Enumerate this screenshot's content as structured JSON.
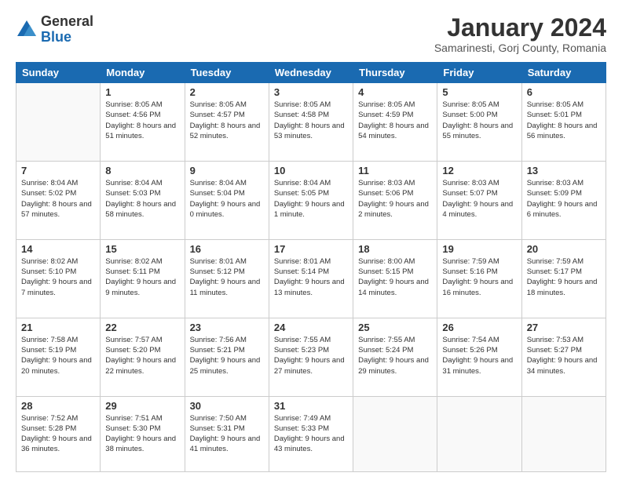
{
  "header": {
    "logo_general": "General",
    "logo_blue": "Blue",
    "month_title": "January 2024",
    "location": "Samarinesti, Gorj County, Romania"
  },
  "days_of_week": [
    "Sunday",
    "Monday",
    "Tuesday",
    "Wednesday",
    "Thursday",
    "Friday",
    "Saturday"
  ],
  "weeks": [
    [
      {
        "day": "",
        "info": ""
      },
      {
        "day": "1",
        "info": "Sunrise: 8:05 AM\nSunset: 4:56 PM\nDaylight: 8 hours\nand 51 minutes."
      },
      {
        "day": "2",
        "info": "Sunrise: 8:05 AM\nSunset: 4:57 PM\nDaylight: 8 hours\nand 52 minutes."
      },
      {
        "day": "3",
        "info": "Sunrise: 8:05 AM\nSunset: 4:58 PM\nDaylight: 8 hours\nand 53 minutes."
      },
      {
        "day": "4",
        "info": "Sunrise: 8:05 AM\nSunset: 4:59 PM\nDaylight: 8 hours\nand 54 minutes."
      },
      {
        "day": "5",
        "info": "Sunrise: 8:05 AM\nSunset: 5:00 PM\nDaylight: 8 hours\nand 55 minutes."
      },
      {
        "day": "6",
        "info": "Sunrise: 8:05 AM\nSunset: 5:01 PM\nDaylight: 8 hours\nand 56 minutes."
      }
    ],
    [
      {
        "day": "7",
        "info": "Sunrise: 8:04 AM\nSunset: 5:02 PM\nDaylight: 8 hours\nand 57 minutes."
      },
      {
        "day": "8",
        "info": "Sunrise: 8:04 AM\nSunset: 5:03 PM\nDaylight: 8 hours\nand 58 minutes."
      },
      {
        "day": "9",
        "info": "Sunrise: 8:04 AM\nSunset: 5:04 PM\nDaylight: 9 hours\nand 0 minutes."
      },
      {
        "day": "10",
        "info": "Sunrise: 8:04 AM\nSunset: 5:05 PM\nDaylight: 9 hours\nand 1 minute."
      },
      {
        "day": "11",
        "info": "Sunrise: 8:03 AM\nSunset: 5:06 PM\nDaylight: 9 hours\nand 2 minutes."
      },
      {
        "day": "12",
        "info": "Sunrise: 8:03 AM\nSunset: 5:07 PM\nDaylight: 9 hours\nand 4 minutes."
      },
      {
        "day": "13",
        "info": "Sunrise: 8:03 AM\nSunset: 5:09 PM\nDaylight: 9 hours\nand 6 minutes."
      }
    ],
    [
      {
        "day": "14",
        "info": "Sunrise: 8:02 AM\nSunset: 5:10 PM\nDaylight: 9 hours\nand 7 minutes."
      },
      {
        "day": "15",
        "info": "Sunrise: 8:02 AM\nSunset: 5:11 PM\nDaylight: 9 hours\nand 9 minutes."
      },
      {
        "day": "16",
        "info": "Sunrise: 8:01 AM\nSunset: 5:12 PM\nDaylight: 9 hours\nand 11 minutes."
      },
      {
        "day": "17",
        "info": "Sunrise: 8:01 AM\nSunset: 5:14 PM\nDaylight: 9 hours\nand 13 minutes."
      },
      {
        "day": "18",
        "info": "Sunrise: 8:00 AM\nSunset: 5:15 PM\nDaylight: 9 hours\nand 14 minutes."
      },
      {
        "day": "19",
        "info": "Sunrise: 7:59 AM\nSunset: 5:16 PM\nDaylight: 9 hours\nand 16 minutes."
      },
      {
        "day": "20",
        "info": "Sunrise: 7:59 AM\nSunset: 5:17 PM\nDaylight: 9 hours\nand 18 minutes."
      }
    ],
    [
      {
        "day": "21",
        "info": "Sunrise: 7:58 AM\nSunset: 5:19 PM\nDaylight: 9 hours\nand 20 minutes."
      },
      {
        "day": "22",
        "info": "Sunrise: 7:57 AM\nSunset: 5:20 PM\nDaylight: 9 hours\nand 22 minutes."
      },
      {
        "day": "23",
        "info": "Sunrise: 7:56 AM\nSunset: 5:21 PM\nDaylight: 9 hours\nand 25 minutes."
      },
      {
        "day": "24",
        "info": "Sunrise: 7:55 AM\nSunset: 5:23 PM\nDaylight: 9 hours\nand 27 minutes."
      },
      {
        "day": "25",
        "info": "Sunrise: 7:55 AM\nSunset: 5:24 PM\nDaylight: 9 hours\nand 29 minutes."
      },
      {
        "day": "26",
        "info": "Sunrise: 7:54 AM\nSunset: 5:26 PM\nDaylight: 9 hours\nand 31 minutes."
      },
      {
        "day": "27",
        "info": "Sunrise: 7:53 AM\nSunset: 5:27 PM\nDaylight: 9 hours\nand 34 minutes."
      }
    ],
    [
      {
        "day": "28",
        "info": "Sunrise: 7:52 AM\nSunset: 5:28 PM\nDaylight: 9 hours\nand 36 minutes."
      },
      {
        "day": "29",
        "info": "Sunrise: 7:51 AM\nSunset: 5:30 PM\nDaylight: 9 hours\nand 38 minutes."
      },
      {
        "day": "30",
        "info": "Sunrise: 7:50 AM\nSunset: 5:31 PM\nDaylight: 9 hours\nand 41 minutes."
      },
      {
        "day": "31",
        "info": "Sunrise: 7:49 AM\nSunset: 5:33 PM\nDaylight: 9 hours\nand 43 minutes."
      },
      {
        "day": "",
        "info": ""
      },
      {
        "day": "",
        "info": ""
      },
      {
        "day": "",
        "info": ""
      }
    ]
  ]
}
